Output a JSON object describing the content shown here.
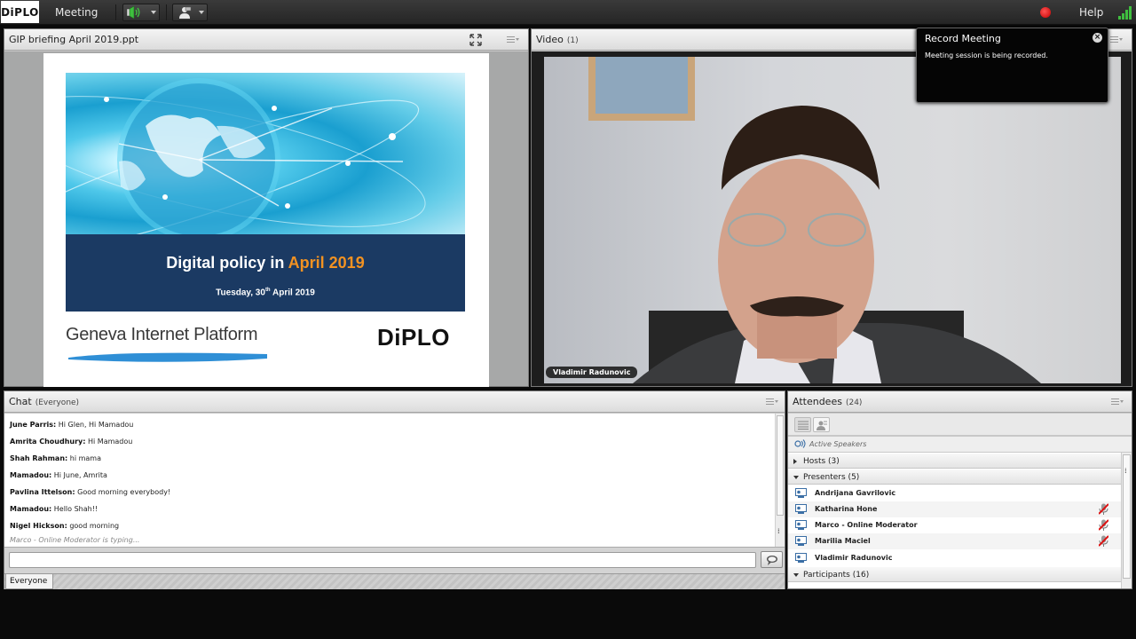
{
  "topbar": {
    "logo_text": "DiPLO",
    "menu_meeting": "Meeting",
    "menu_help": "Help",
    "record_color": "#d40000",
    "speaker_icon": "speaker-on-icon",
    "camera_icon": "webcam-person-icon",
    "signal_icon": "connection-signal-icon"
  },
  "share_pod": {
    "title": "GIP briefing April 2019.ppt",
    "fullscreen_icon": "fullscreen-icon",
    "slide": {
      "title_main": "Digital policy in ",
      "title_highlight": "April 2019",
      "date_prefix": "Tuesday, 30",
      "date_sup": "th",
      "date_suffix": " April 2019",
      "left_logo_text": "Geneva Internet Platform",
      "right_logo_text": "DiPLO",
      "band_color": "#1b3a63",
      "highlight_color": "#f29222"
    }
  },
  "video_pod": {
    "title": "Video",
    "count": "(1)",
    "speaker_label": "Vladimir Radunovic"
  },
  "record_popup": {
    "title": "Record Meeting",
    "message": "Meeting session is being recorded."
  },
  "chat_pod": {
    "title": "Chat",
    "scope": "(Everyone)",
    "messages": [
      {
        "sender": "June Parris:",
        "text": " Hi Glen, Hi Mamadou"
      },
      {
        "sender": "Amrita Choudhury:",
        "text": " Hi Mamadou"
      },
      {
        "sender": "Shah Rahman:",
        "text": " hi mama"
      },
      {
        "sender": "Mamadou:",
        "text": " Hi June, Amrita"
      },
      {
        "sender": "Pavlina Ittelson:",
        "text": " Good morning everybody!"
      },
      {
        "sender": "Mamadou:",
        "text": " Hello Shah!!"
      },
      {
        "sender": "Nigel Hickson:",
        "text": " good morning"
      }
    ],
    "typing": "Marco - Online Moderator is typing...",
    "input_value": "",
    "tab_label": "Everyone"
  },
  "attendees_pod": {
    "title": "Attendees",
    "count": "(24)",
    "active_speakers_label": "Active Speakers",
    "groups": {
      "hosts": "Hosts (3)",
      "presenters": "Presenters (5)",
      "participants": "Participants (16)"
    },
    "presenters": [
      {
        "name": "Andrijana Gavrilovic",
        "mic": false
      },
      {
        "name": "Katharina Hone",
        "mic": true
      },
      {
        "name": "Marco - Online Moderator",
        "mic": true
      },
      {
        "name": "Marilia Maciel",
        "mic": true
      },
      {
        "name": "Vladimir Radunovic",
        "mic": false
      }
    ]
  }
}
